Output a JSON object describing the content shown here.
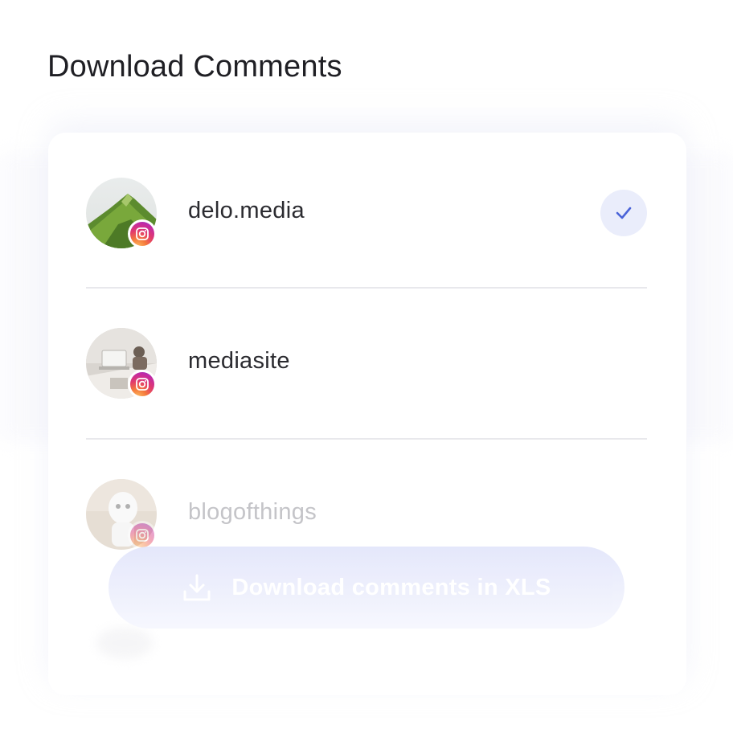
{
  "page": {
    "title": "Download Comments"
  },
  "accounts": [
    {
      "name": "delo.media",
      "network": "instagram",
      "selected": true
    },
    {
      "name": "mediasite",
      "network": "instagram",
      "selected": false
    },
    {
      "name": "blogofthings",
      "network": "instagram",
      "selected": false
    }
  ],
  "action": {
    "download_label": "Download comments in XLS",
    "icon": "download-icon"
  },
  "colors": {
    "accent": "#4a63d8",
    "check_bg": "#eaedfb",
    "button_bg": "#e3e6fb",
    "title": "#1f1f24"
  }
}
